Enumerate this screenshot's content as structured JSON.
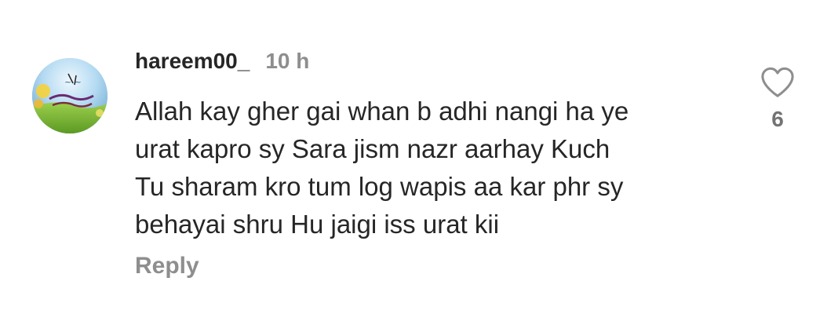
{
  "comment": {
    "username": "hareem00_",
    "timestamp": "10 h",
    "text_lines": [
      "Allah kay gher gai whan b adhi nangi ha ye",
      "urat kapro sy Sara jism nazr aarhay Kuch",
      "Tu sharam kro tum log wapis aa kar phr sy",
      "behayai shru Hu jaigi iss urat kii"
    ],
    "reply_label": "Reply",
    "like_count": "6",
    "like_icon": "heart-icon",
    "avatar_icon": "profile-avatar-image"
  },
  "colors": {
    "text_primary": "#262626",
    "text_secondary": "#8e8e8e",
    "background": "#ffffff"
  }
}
